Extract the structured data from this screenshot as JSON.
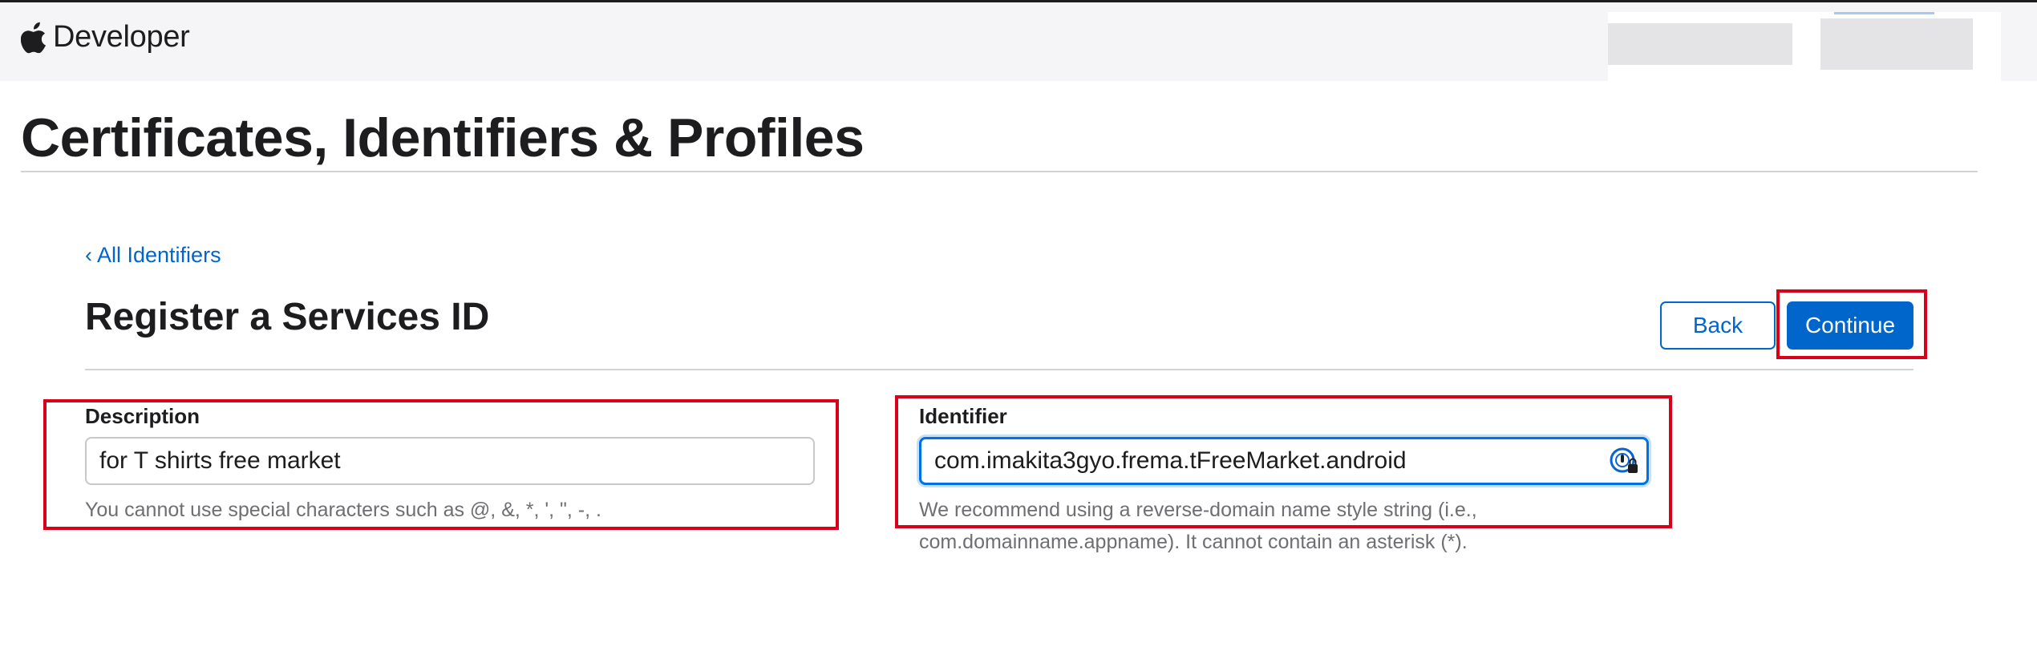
{
  "nav": {
    "brand": "Developer",
    "apple_icon": "apple-logo-icon"
  },
  "page": {
    "title": "Certificates, Identifiers & Profiles"
  },
  "breadcrumb": {
    "back_link": "‹ All Identifiers"
  },
  "section": {
    "title": "Register a Services ID",
    "back_button": "Back",
    "continue_button": "Continue"
  },
  "form": {
    "description": {
      "label": "Description",
      "value": "for T shirts free market",
      "hint": "You cannot use special characters such as @, &, *, ', \", -, ."
    },
    "identifier": {
      "label": "Identifier",
      "value": "com.imakita3gyo.frema.tFreeMarket.android",
      "hint_line1": "We recommend using a reverse-domain name style string (i.e.,",
      "hint_line2": "com.domainname.appname). It cannot contain an asterisk (*).",
      "autofill_icon": "password-manager-icon"
    }
  },
  "colors": {
    "accent": "#0066cc",
    "highlight": "#d9001b",
    "focus_ring": "#0071e3"
  }
}
